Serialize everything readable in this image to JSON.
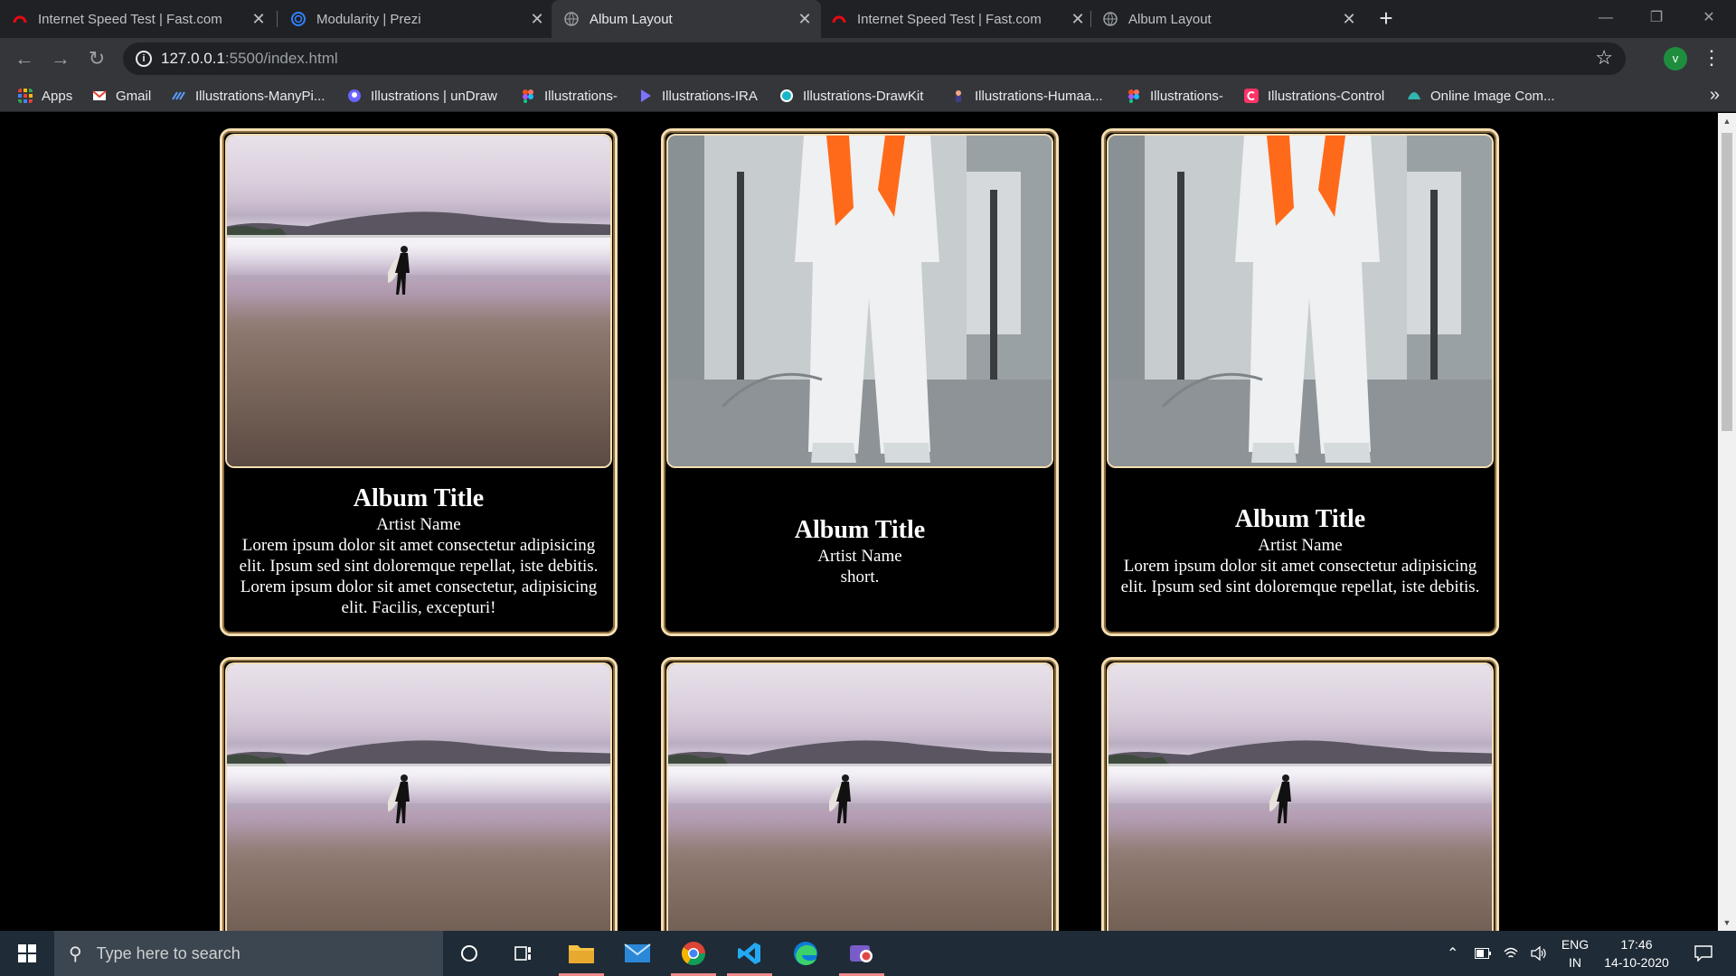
{
  "browser": {
    "tabs": [
      {
        "title": "Internet Speed Test | Fast.com",
        "icon": "fast-com-icon",
        "active": false
      },
      {
        "title": "Modularity | Prezi",
        "icon": "prezi-icon",
        "active": false
      },
      {
        "title": "Album Layout",
        "icon": "globe-icon",
        "active": true
      },
      {
        "title": "Internet Speed Test | Fast.com",
        "icon": "fast-com-icon",
        "active": false
      },
      {
        "title": "Album Layout",
        "icon": "globe-icon",
        "active": false
      }
    ],
    "url_host": "127.0.0.1",
    "url_rest": ":5500/index.html",
    "profile_initial": "v",
    "bookmarks": [
      {
        "label": "Apps",
        "icon": "apps-grid-icon"
      },
      {
        "label": "Gmail",
        "icon": "gmail-icon"
      },
      {
        "label": "Illustrations-ManyPi...",
        "icon": "manypixels-icon"
      },
      {
        "label": "Illustrations | unDraw",
        "icon": "undraw-icon"
      },
      {
        "label": "Illustrations-",
        "icon": "figma-icon"
      },
      {
        "label": "Illustrations-IRA",
        "icon": "ira-icon"
      },
      {
        "label": "Illustrations-DrawKit",
        "icon": "drawkit-icon"
      },
      {
        "label": "Illustrations-Humaa...",
        "icon": "humaaans-icon"
      },
      {
        "label": "Illustrations-",
        "icon": "figma-icon"
      },
      {
        "label": "Illustrations-Control",
        "icon": "control-icon"
      },
      {
        "label": "Online Image Com...",
        "icon": "image-compressor-icon"
      }
    ]
  },
  "albums": [
    {
      "title": "Album Title",
      "artist": "Artist Name",
      "description": "Lorem ipsum dolor sit amet consectetur adipisicing elit. Ipsum sed sint doloremque repellat, iste debitis. Lorem ipsum dolor sit amet consectetur, adipisicing elit. Facilis, excepturi!",
      "image": "beach-surfer-photo"
    },
    {
      "title": "Album Title",
      "artist": "Artist Name",
      "description": "short.",
      "image": "protective-suit-photo"
    },
    {
      "title": "Album Title",
      "artist": "Artist Name",
      "description": "Lorem ipsum dolor sit amet consectetur adipisicing elit. Ipsum sed sint doloremque repellat, iste debitis.",
      "image": "protective-suit-photo"
    },
    {
      "title": "",
      "artist": "",
      "description": "",
      "image": "beach-surfer-photo"
    },
    {
      "title": "",
      "artist": "",
      "description": "",
      "image": "beach-surfer-photo"
    },
    {
      "title": "",
      "artist": "",
      "description": "",
      "image": "beach-surfer-photo"
    }
  ],
  "taskbar": {
    "search_placeholder": "Type here to search",
    "language_top": "ENG",
    "language_bottom": "IN",
    "time": "17:46",
    "date": "14-10-2020"
  }
}
